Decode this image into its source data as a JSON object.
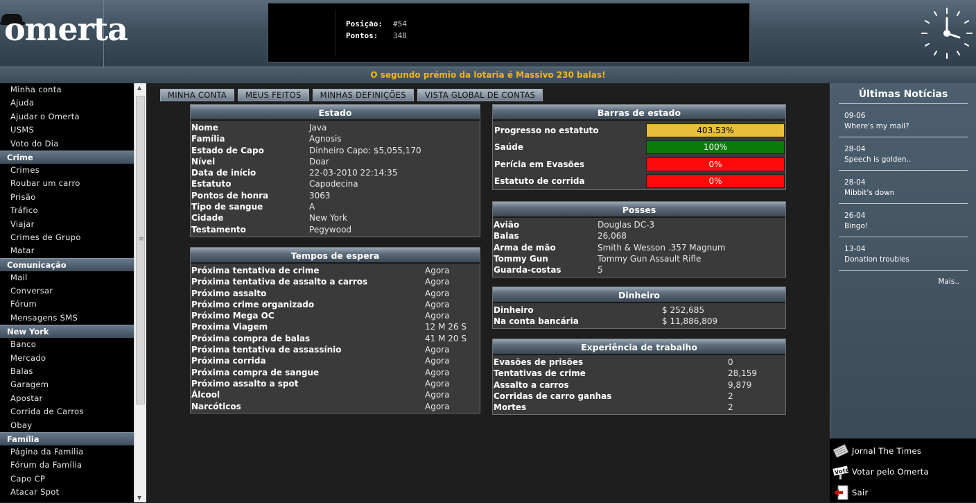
{
  "header": {
    "logo_text": "omerta",
    "stats": [
      {
        "label": "Posição:",
        "value": "#54"
      },
      {
        "label": "Pontos:",
        "value": "348"
      }
    ]
  },
  "lottery_banner": "O segundo prémio da lotaria é Massivo 230 balas!",
  "leftmenu": {
    "top_items": [
      "Minha conta",
      "Ajuda",
      "Ajudar o Omerta",
      "USMS",
      "Voto do Dia"
    ],
    "groups": [
      {
        "title": "Crime",
        "items": [
          "Crimes",
          "Roubar um carro",
          "Prisão",
          "Tráfico",
          "Viajar",
          "Crimes de Grupo",
          "Matar"
        ]
      },
      {
        "title": "Comunicação",
        "items": [
          "Mail",
          "Conversar",
          "Fórum",
          "Mensagens SMS"
        ]
      },
      {
        "title": "New York",
        "items": [
          "Banco",
          "Mercado",
          "Balas",
          "Garagem",
          "Apostar",
          "Corrida de Carros",
          "Obay"
        ]
      },
      {
        "title": "Família",
        "items": [
          "Página da Família",
          "Fórum da Família",
          "Capo CP",
          "Atacar Spot"
        ]
      }
    ]
  },
  "tabs": [
    "MINHA CONTA",
    "MEUS FEITOS",
    "MINHAS DEFINIÇÕES",
    "VISTA GLOBAL DE CONTAS"
  ],
  "estado": {
    "title": "Estado",
    "rows": [
      {
        "k": "Nome",
        "v": "Java"
      },
      {
        "k": "Família",
        "v": "Agnosis"
      },
      {
        "k": "Estado de Capo",
        "v": "Dinheiro Capo: $5,055,170"
      },
      {
        "k": "Nível",
        "v": "Doar"
      },
      {
        "k": "Data de início",
        "v": "22-03-2010 22:14:35"
      },
      {
        "k": "Estatuto",
        "v": "Capodecina"
      },
      {
        "k": "Pontos de honra",
        "v": "3063"
      },
      {
        "k": "Tipo de sangue",
        "v": "A"
      },
      {
        "k": "Cidade",
        "v": "New York"
      },
      {
        "k": "Testamento",
        "v": "Pegywood"
      }
    ]
  },
  "tempos": {
    "title": "Tempos de espera",
    "rows": [
      {
        "k": "Próxima tentativa de crime",
        "v": "Agora"
      },
      {
        "k": "Próxima tentativa de assalto a carros",
        "v": "Agora"
      },
      {
        "k": "Próximo assalto",
        "v": "Agora"
      },
      {
        "k": "Próximo crime organizado",
        "v": "Agora"
      },
      {
        "k": "Próximo Mega OC",
        "v": "Agora"
      },
      {
        "k": "Proxima Viagem",
        "v": "12 M 26 S"
      },
      {
        "k": "Próxima compra de balas",
        "v": "41 M 20 S"
      },
      {
        "k": "Próxima tentativa de assassínio",
        "v": "Agora"
      },
      {
        "k": "Próxima corrida",
        "v": "Agora"
      },
      {
        "k": "Próxima compra de sangue",
        "v": "Agora"
      },
      {
        "k": "Próximo assalto a spot",
        "v": "Agora"
      },
      {
        "k": "Álcool",
        "v": "Agora"
      },
      {
        "k": "Narcóticos",
        "v": "Agora"
      }
    ]
  },
  "barras": {
    "title": "Barras de estado",
    "rows": [
      {
        "k": "Progresso no estatuto",
        "v": "403.53%",
        "color": "#e8bf3b"
      },
      {
        "k": "Saúde",
        "v": "100%",
        "color": "#0a7a0a"
      },
      {
        "k": "Perícia em Evasões",
        "v": "0%",
        "color": "#ff0a0a"
      },
      {
        "k": "Estatuto de corrida",
        "v": "0%",
        "color": "#ff0a0a"
      }
    ]
  },
  "posses": {
    "title": "Posses",
    "rows": [
      {
        "k": "Avião",
        "v": "Douglas DC-3"
      },
      {
        "k": "Balas",
        "v": "26,068"
      },
      {
        "k": "Arma de mão",
        "v": "Smith & Wesson .357 Magnum"
      },
      {
        "k": "Tommy Gun",
        "v": "Tommy Gun Assault Rifle"
      },
      {
        "k": "Guarda-costas",
        "v": "5"
      }
    ]
  },
  "dinheiro": {
    "title": "Dinheiro",
    "rows": [
      {
        "k": "Dinheiro",
        "v": "$ 252,685"
      },
      {
        "k": "Na conta bancária",
        "v": "$ 11,886,809"
      }
    ]
  },
  "experiencia": {
    "title": "Experiência de trabalho",
    "rows": [
      {
        "k": "Evasões de prisões",
        "v": "0"
      },
      {
        "k": "Tentativas de crime",
        "v": "28,159"
      },
      {
        "k": "Assalto a carros",
        "v": "9,879"
      },
      {
        "k": "Corridas de carro ganhas",
        "v": "2"
      },
      {
        "k": "Mortes",
        "v": "2"
      }
    ]
  },
  "news": {
    "title": "Últimas Notícias",
    "items": [
      {
        "date": "09-06",
        "text": "Where's my mail?"
      },
      {
        "date": "28-04",
        "text": "Speech is golden.."
      },
      {
        "date": "28-04",
        "text": "Mibbit's down"
      },
      {
        "date": "26-04",
        "text": "Bingo!"
      },
      {
        "date": "13-04",
        "text": "Donation troubles"
      }
    ],
    "more": "Mais.."
  },
  "bottom_links": [
    {
      "icon": "newspaper-icon",
      "label": "Jornal The Times"
    },
    {
      "icon": "vote-icon",
      "label": "Votar pelo Omerta"
    },
    {
      "icon": "exit-icon",
      "label": "Sair"
    }
  ]
}
